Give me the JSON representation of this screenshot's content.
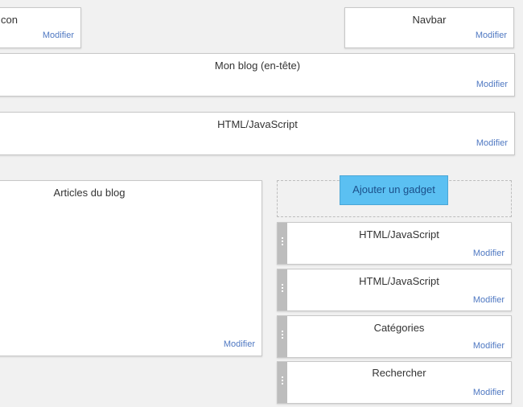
{
  "top": {
    "favicon": {
      "title": "con",
      "edit": "Modifier"
    },
    "navbar": {
      "title": "Navbar",
      "edit": "Modifier"
    }
  },
  "header": {
    "title": "Mon blog (en-tête)",
    "edit": "Modifier"
  },
  "html_wide": {
    "title": "HTML/JavaScript",
    "edit": "Modifier"
  },
  "main": {
    "title": "Articles du blog",
    "edit": "Modifier"
  },
  "sidebar": {
    "add_gadget": "Ajouter un gadget",
    "gadgets": [
      {
        "title": "HTML/JavaScript",
        "edit": "Modifier"
      },
      {
        "title": "HTML/JavaScript",
        "edit": "Modifier"
      },
      {
        "title": "Catégories",
        "edit": "Modifier"
      },
      {
        "title": "Rechercher",
        "edit": "Modifier"
      }
    ]
  }
}
